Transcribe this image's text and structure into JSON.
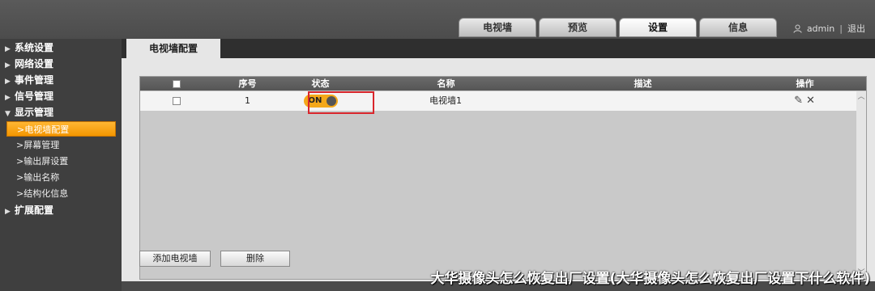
{
  "top_tabs": [
    "电视墙",
    "预览",
    "设置",
    "信息"
  ],
  "user": {
    "name": "admin",
    "separator": "|",
    "logout": "退出"
  },
  "sidebar": {
    "system": "系统设置",
    "network": "网络设置",
    "event": "事件管理",
    "signal": "信号管理",
    "display": "显示管理",
    "display_items": [
      "电视墙配置",
      "屏幕管理",
      "输出屏设置",
      "输出名称",
      "结构化信息"
    ],
    "expand": "扩展配置"
  },
  "content": {
    "page_tab": "电视墙配置",
    "columns": {
      "index": "序号",
      "status": "状态",
      "name": "名称",
      "desc": "描述",
      "action": "操作"
    },
    "rows": [
      {
        "index": "1",
        "status": "ON",
        "name": "电视墙1",
        "desc": ""
      }
    ],
    "buttons": {
      "add": "添加电视墙",
      "delete": "删除"
    }
  },
  "watermark": "大华摄像头怎么恢复出厂设置(大华摄像头怎么恢复出厂设置下什么软件)",
  "colors": {
    "accent": "#f39600",
    "toggle_on": "#f4a81a",
    "highlight": "#d9262c"
  }
}
